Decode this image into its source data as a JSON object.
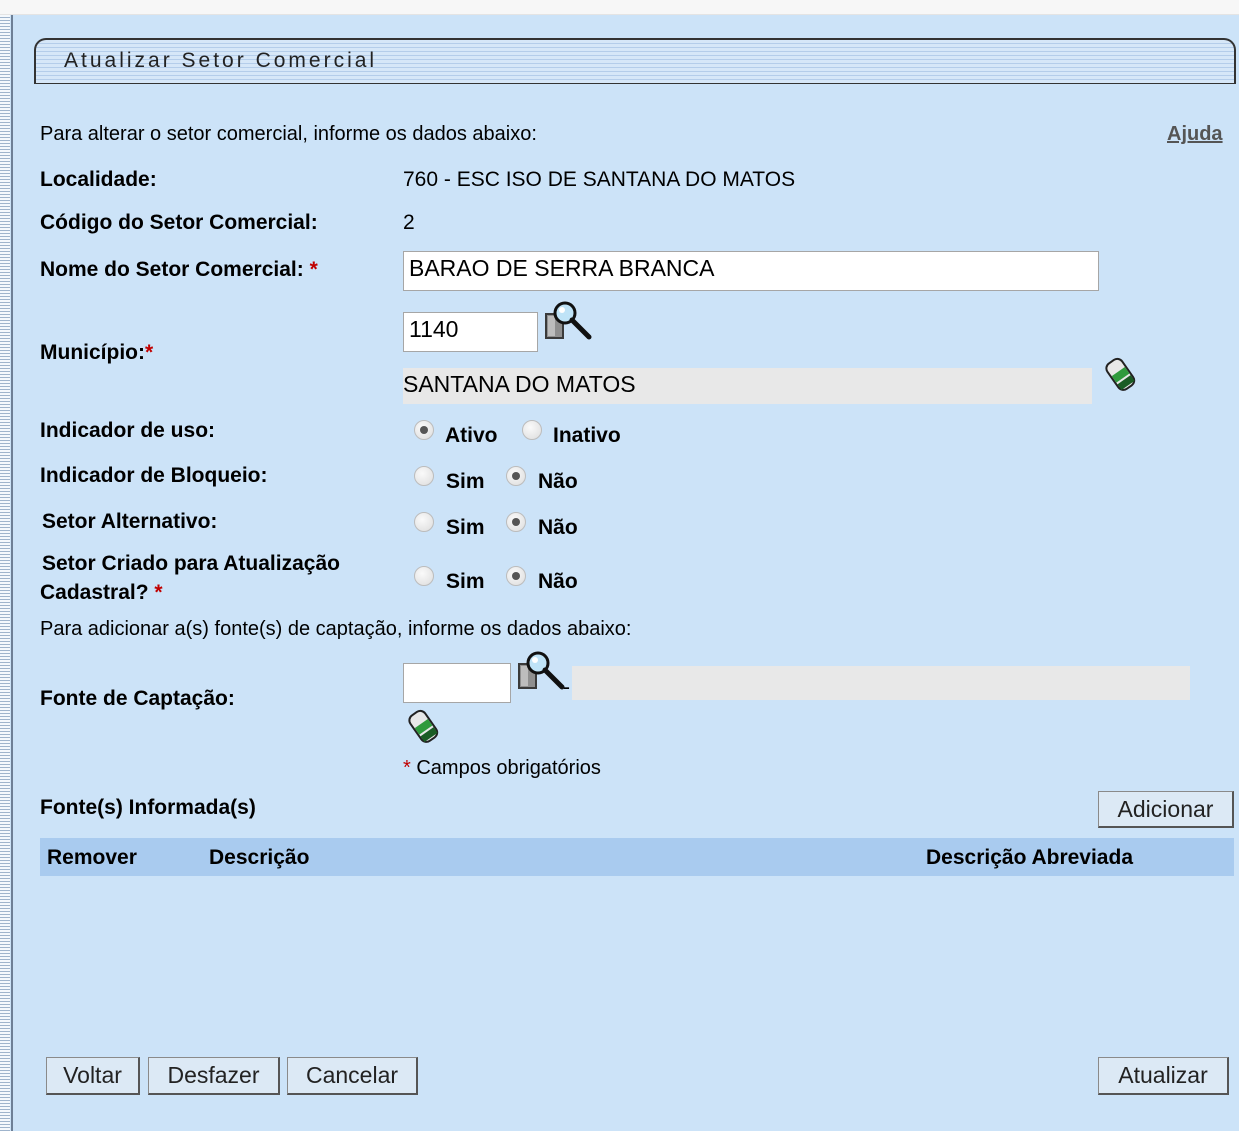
{
  "title": "Atualizar Setor Comercial",
  "intro": "Para alterar o setor comercial, informe os dados abaixo:",
  "help_link": "Ajuda",
  "localidade": {
    "label": "Localidade:",
    "value": "760 - ESC ISO DE SANTANA DO MATOS"
  },
  "codigo": {
    "label": "Código do Setor Comercial:",
    "value": "2"
  },
  "nome": {
    "label": "Nome do Setor Comercial:",
    "required": "*",
    "value": "BARAO DE SERRA BRANCA"
  },
  "municipio": {
    "label": "Município:",
    "required": "*",
    "code": "1140",
    "name": "SANTANA DO MATOS"
  },
  "indicador_uso": {
    "label": "Indicador de uso:",
    "options": [
      "Ativo",
      "Inativo"
    ],
    "selected": "Ativo"
  },
  "indicador_bloqueio": {
    "label": "Indicador de Bloqueio:",
    "options": [
      "Sim",
      "Não"
    ],
    "selected": "Não"
  },
  "setor_alternativo": {
    "label": "Setor Alternativo:",
    "options": [
      "Sim",
      "Não"
    ],
    "selected": "Não"
  },
  "setor_criado": {
    "label_line1": "Setor Criado para Atualização",
    "label_line2": "Cadastral?",
    "required": "*",
    "options": [
      "Sim",
      "Não"
    ],
    "selected": "Não"
  },
  "fonte_intro": "Para adicionar a(s) fonte(s) de captação, informe os dados abaixo:",
  "fonte_captacao": {
    "label": "Fonte de Captação:",
    "code": "",
    "separator": "-",
    "description": ""
  },
  "required_note": {
    "mark": "*",
    "text": "Campos obrigatórios"
  },
  "fontes_informadas": {
    "label": "Fonte(s) Informada(s)",
    "add_button": "Adicionar",
    "columns": [
      "Remover",
      "Descrição",
      "Descrição Abreviada"
    ],
    "rows": []
  },
  "buttons": {
    "voltar": "Voltar",
    "desfazer": "Desfazer",
    "cancelar": "Cancelar",
    "atualizar": "Atualizar"
  },
  "icons": {
    "search": "magnifier-search-icon",
    "clear": "eraser-clear-icon"
  }
}
